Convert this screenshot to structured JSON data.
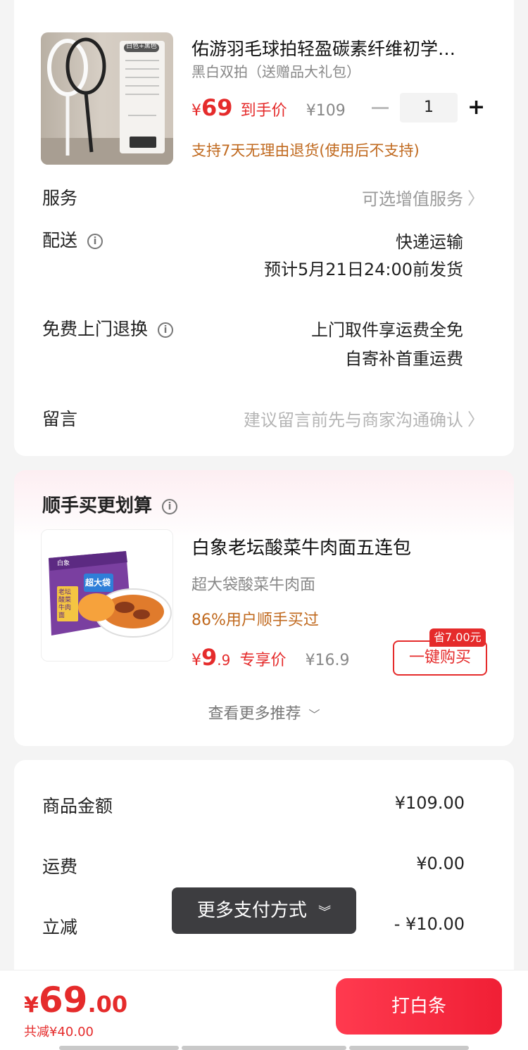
{
  "product": {
    "title": "佑游羽毛球拍轻盈碳素纤维初学…",
    "variant": "黑白双拍（送赠品大礼包）",
    "price_symbol": "¥",
    "price": "69",
    "price_label": "到手价",
    "original_price": "¥109",
    "quantity": "1",
    "return_policy": "支持7天无理由退货(使用后不支持)",
    "image_tag": "白色+黑色"
  },
  "rows": {
    "service_label": "服务",
    "service_value": "可选增值服务",
    "delivery_label": "配送",
    "delivery_value": "快递运输",
    "delivery_eta": "预计5月21日24:00前发货",
    "return_label": "免费上门退换",
    "return_line1": "上门取件享运费全免",
    "return_line2": "自寄补首重运费",
    "message_label": "留言",
    "message_placeholder": "建议留言前先与商家沟通确认"
  },
  "recommend": {
    "heading": "顺手买更划算",
    "title": "白象老坛酸菜牛肉面五连包",
    "subtitle": "超大袋酸菜牛肉面",
    "social_proof": "86%用户顺手买过",
    "price_symbol": "¥",
    "price_int": "9",
    "price_dec": ".9",
    "price_label": "专享价",
    "original_price": "¥16.9",
    "save_tag": "省7.00元",
    "buy_button": "一键购买",
    "more": "查看更多推荐",
    "package_brand": "白象",
    "package_flavor": "老坛酸菜牛肉面",
    "package_badge": "超大袋"
  },
  "summary": {
    "goods_label": "商品金额",
    "goods_value": "¥109.00",
    "shipping_label": "运费",
    "shipping_value": "¥0.00",
    "discount_label": "立减",
    "discount_value": "- ¥10.00"
  },
  "toast": {
    "label": "更多支付方式"
  },
  "bottom": {
    "symbol": "¥",
    "total_int": "69",
    "total_dec": ".00",
    "saved": "共减¥40.00",
    "pay_button": "打白条"
  },
  "colors": {
    "accent_red": "#e52b2b",
    "orange": "#c0691e",
    "toast_bg": "#3d3d40"
  }
}
